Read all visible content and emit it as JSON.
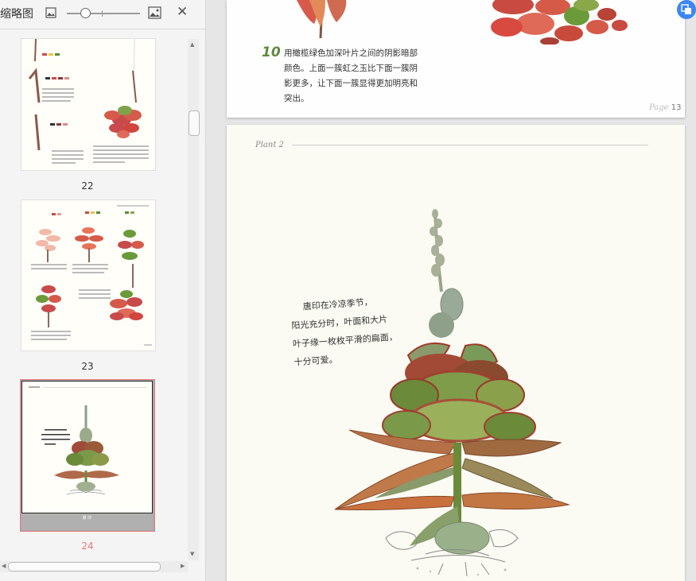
{
  "panel": {
    "title": "缩略图",
    "close_symbol": "✕",
    "zoom_icons": [
      "small-image-icon",
      "large-image-icon"
    ],
    "thumbnails": [
      {
        "page_label": "22"
      },
      {
        "page_label": "23"
      },
      {
        "page_label": "24",
        "selected": true,
        "caption": "景 印"
      }
    ],
    "accent_color": "#e77a7a"
  },
  "page13": {
    "step_number": "10",
    "step_text": "用橄榄绿色加深叶片之间的阴影暗部颜色。上面一簇虹之玉比下面一簇阴影更多，让下面一簇显得更加明亮和突出。",
    "footer_word": "Page",
    "footer_number": "13"
  },
  "page14": {
    "plant_label": "Plant 2",
    "handwriting": [
      "唐印在冷凉季节，",
      "阳光充分时，叶面和大片",
      "叶子缘一枚枚平滑的扁面，",
      "十分可爱。"
    ]
  },
  "float_button_icon": "translate-icon"
}
